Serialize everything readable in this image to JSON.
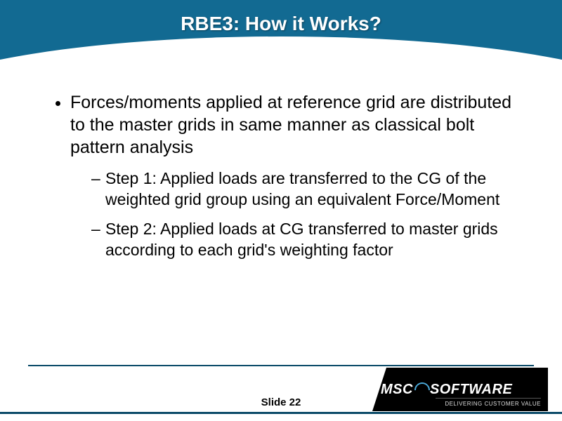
{
  "title": "RBE3: How it Works?",
  "content": {
    "main": "Forces/moments applied at reference grid are distributed to the master grids in same manner as classical bolt pattern analysis",
    "sub1": "Step 1: Applied loads are transferred to the CG of the weighted grid group using an equivalent Force/Moment",
    "sub2": "Step 2: Applied loads at CG transferred to master grids according to each grid's weighting factor"
  },
  "footer": {
    "slide_label": "Slide 22"
  },
  "logo": {
    "brand_left": "MSC",
    "brand_right": "SOFTWARE",
    "tagline": "DELIVERING CUSTOMER VALUE"
  }
}
